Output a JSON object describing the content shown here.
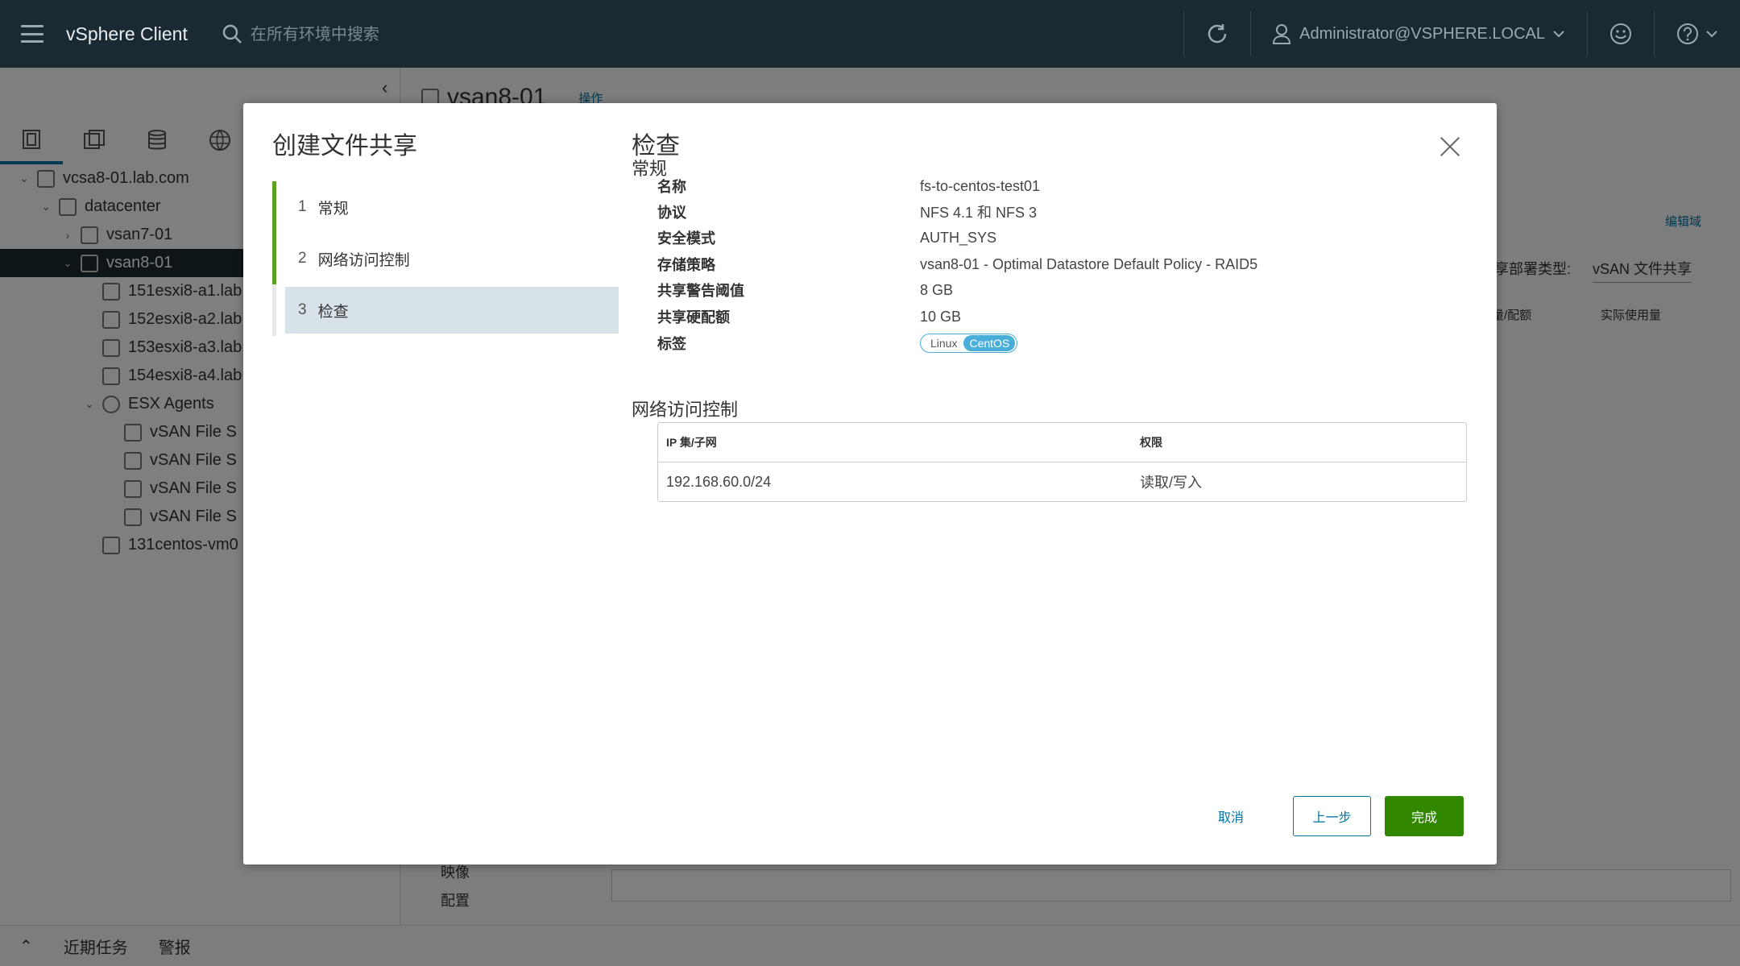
{
  "header": {
    "app_title": "vSphere Client",
    "search_placeholder": "在所有环境中搜索",
    "user": "Administrator@VSPHERE.LOCAL"
  },
  "nav": {
    "tree": [
      {
        "label": "vcsa8-01.lab.com",
        "level": 0,
        "expanded": true
      },
      {
        "label": "datacenter",
        "level": 1,
        "expanded": true
      },
      {
        "label": "vsan7-01",
        "level": 2,
        "expanded": false
      },
      {
        "label": "vsan8-01",
        "level": 2,
        "expanded": true,
        "selected": true
      },
      {
        "label": "151esxi8-a1.lab.",
        "level": 3
      },
      {
        "label": "152esxi8-a2.lab",
        "level": 3
      },
      {
        "label": "153esxi8-a3.lab",
        "level": 3
      },
      {
        "label": "154esxi8-a4.lab",
        "level": 3
      },
      {
        "label": "ESX Agents",
        "level": 3,
        "expanded": true
      },
      {
        "label": "vSAN File S",
        "level": 4
      },
      {
        "label": "vSAN File S",
        "level": 4
      },
      {
        "label": "vSAN File S",
        "level": 4
      },
      {
        "label": "vSAN File S",
        "level": 4
      },
      {
        "label": "131centos-vm0",
        "level": 3
      }
    ]
  },
  "background": {
    "object_title": "vsan8-01",
    "actions": "操作",
    "edit_domain": "编辑域",
    "deploy_type_label": "共享部署类型:",
    "deploy_type_value": "vSAN 文件共享",
    "col_quota": "量/配额",
    "col_actual": "实际使用量",
    "left_items": [
      "映像",
      "配置"
    ]
  },
  "bottom_bar": {
    "recent_tasks": "近期任务",
    "alarms": "警报"
  },
  "wizard": {
    "title": "创建文件共享",
    "steps": [
      {
        "num": "1",
        "label": "常规"
      },
      {
        "num": "2",
        "label": "网络访问控制"
      },
      {
        "num": "3",
        "label": "检查"
      }
    ],
    "page_title": "检查",
    "general_heading": "常规",
    "general": [
      {
        "key": "名称",
        "value": "fs-to-centos-test01"
      },
      {
        "key": "协议",
        "value": "NFS 4.1 和 NFS 3"
      },
      {
        "key": "安全模式",
        "value": "AUTH_SYS"
      },
      {
        "key": "存储策略",
        "value": "vsan8-01 - Optimal Datastore Default Policy - RAID5"
      },
      {
        "key": "共享警告阈值",
        "value": "8 GB"
      },
      {
        "key": "共享硬配额",
        "value": "10 GB"
      }
    ],
    "tag_key": "标签",
    "tag_category": "Linux",
    "tag_value": "CentOS",
    "acl_heading": "网络访问控制",
    "acl_columns": [
      "IP 集/子网",
      "权限"
    ],
    "acl_rows": [
      [
        "192.168.60.0/24",
        "读取/写入"
      ]
    ],
    "buttons": {
      "cancel": "取消",
      "back": "上一步",
      "finish": "完成"
    }
  }
}
